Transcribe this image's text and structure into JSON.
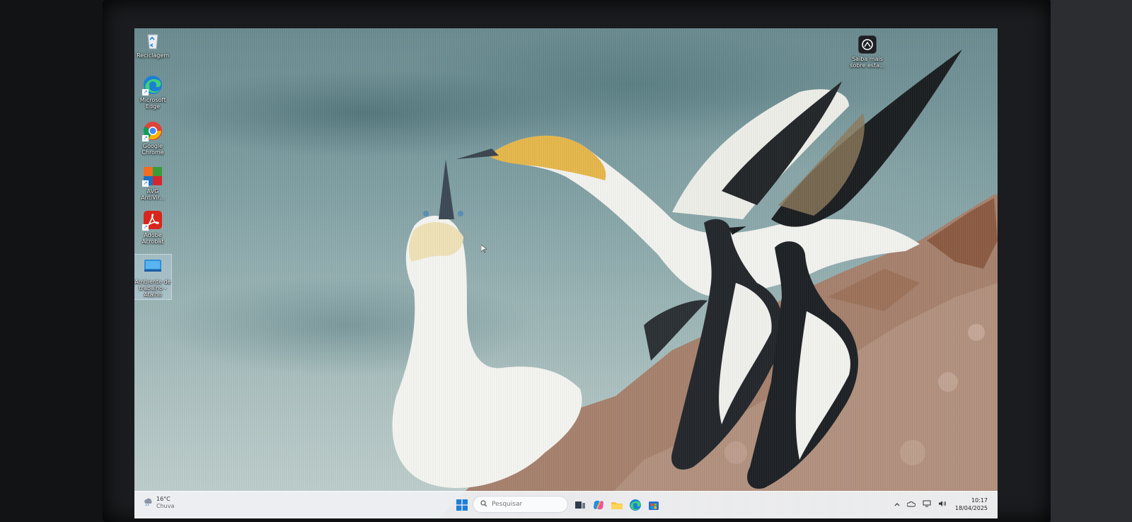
{
  "desktop": {
    "icons": [
      {
        "label": "Reciclagem",
        "icon": "recycle-bin-icon"
      },
      {
        "label": "Microsoft Edge",
        "icon": "edge-icon"
      },
      {
        "label": "Google Chrome",
        "icon": "chrome-icon"
      },
      {
        "label": "AVG AntiVir...",
        "icon": "avg-icon"
      },
      {
        "label": "Adobe Acrobat",
        "icon": "acrobat-icon"
      },
      {
        "label": "Ambiente de trabalho - Atalho",
        "icon": "desktop-shortcut-icon"
      }
    ],
    "learn_more": {
      "label": "Saiba mais sobre esta...",
      "icon": "camera-info-icon"
    }
  },
  "taskbar": {
    "weather": {
      "temperature": "16°C",
      "condition": "Chuva"
    },
    "search_placeholder": "Pesquisar",
    "apps": [
      "task-view-icon",
      "copilot-icon",
      "file-explorer-icon",
      "edge-icon",
      "store-icon"
    ],
    "tray": [
      "chevron-up-icon",
      "onedrive-icon",
      "network-icon",
      "volume-icon"
    ],
    "clock": {
      "time": "10:17",
      "date": "18/04/2025"
    }
  },
  "colors": {
    "taskbar_bg": "#eef0f3",
    "edge_blue": "#1b7fd6",
    "chrome_red": "#db4437",
    "acrobat_red": "#d8261c"
  }
}
